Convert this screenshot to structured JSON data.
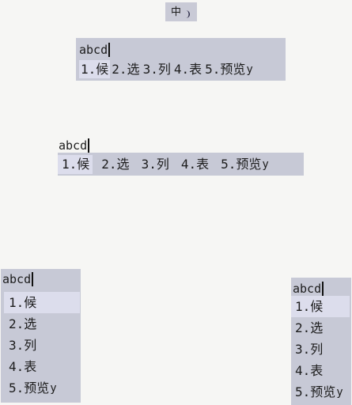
{
  "status": {
    "mode_label": "中",
    "icon": "moon-icon"
  },
  "colors": {
    "panel_bg": "#c7c9d6",
    "highlight_bg": "#dcddec",
    "page_bg": "#f6f6f4"
  },
  "panels": [
    {
      "name": "horizontal-compact",
      "preedit": "abcd",
      "selected_index": 0,
      "candidates": [
        {
          "num": "1.",
          "text": "候",
          "comment": ""
        },
        {
          "num": "2.",
          "text": "选",
          "comment": ""
        },
        {
          "num": "3.",
          "text": "列",
          "comment": ""
        },
        {
          "num": "4.",
          "text": "表",
          "comment": ""
        },
        {
          "num": "5.",
          "text": "预览",
          "comment": "y"
        }
      ]
    },
    {
      "name": "horizontal-spaced",
      "preedit": "abcd",
      "selected_index": 0,
      "candidates": [
        {
          "num": "1.",
          "text": "候",
          "comment": ""
        },
        {
          "num": "2.",
          "text": "选",
          "comment": ""
        },
        {
          "num": "3.",
          "text": "列",
          "comment": ""
        },
        {
          "num": "4.",
          "text": "表",
          "comment": ""
        },
        {
          "num": "5.",
          "text": "预览",
          "comment": "y"
        }
      ]
    },
    {
      "name": "vertical-left",
      "preedit": "abcd",
      "selected_index": 0,
      "candidates": [
        {
          "num": "1.",
          "text": "候",
          "comment": ""
        },
        {
          "num": "2.",
          "text": "选",
          "comment": ""
        },
        {
          "num": "3.",
          "text": "列",
          "comment": ""
        },
        {
          "num": "4.",
          "text": "表",
          "comment": ""
        },
        {
          "num": "5.",
          "text": "预览",
          "comment": "y"
        }
      ]
    },
    {
      "name": "vertical-right",
      "preedit": "abcd",
      "selected_index": 0,
      "candidates": [
        {
          "num": "1.",
          "text": "候",
          "comment": ""
        },
        {
          "num": "2.",
          "text": "选",
          "comment": ""
        },
        {
          "num": "3.",
          "text": "列",
          "comment": ""
        },
        {
          "num": "4.",
          "text": "表",
          "comment": ""
        },
        {
          "num": "5.",
          "text": "预览",
          "comment": "y"
        }
      ]
    }
  ]
}
